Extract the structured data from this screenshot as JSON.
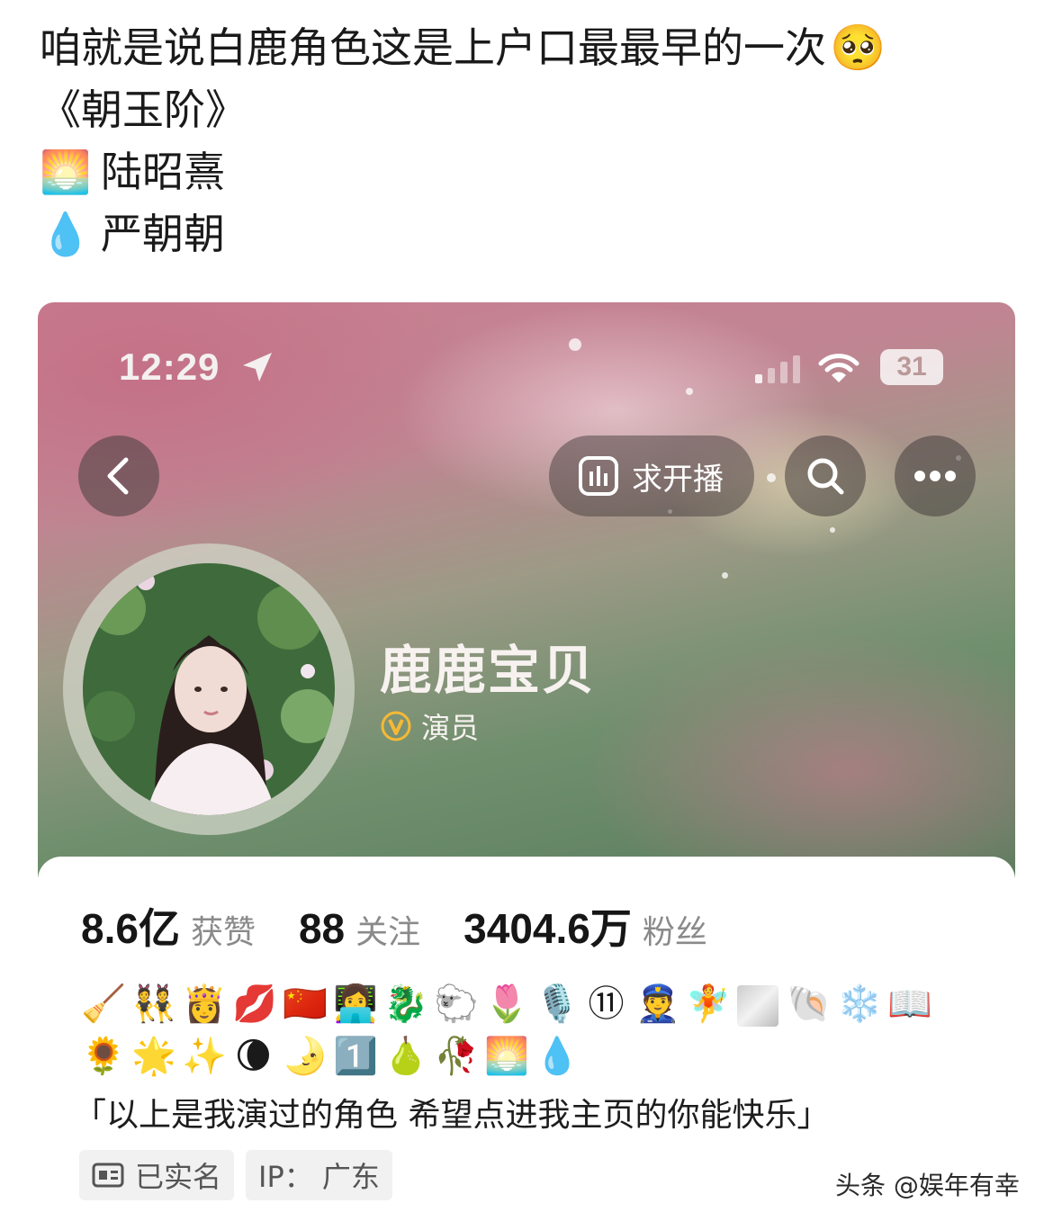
{
  "post": {
    "line1": "咱就是说白鹿角色这是上户口最最早的一次",
    "line1_emoji": "🥺",
    "line2": "《朝玉阶》",
    "line3_emoji": "🌅",
    "line3": "陆昭熹",
    "line4_emoji": "💧",
    "line4": "严朝朝"
  },
  "screenshot": {
    "status_bar": {
      "time": "12:29",
      "battery": "31"
    },
    "top_bar": {
      "live_request_label": "求开播"
    },
    "profile": {
      "nickname": "鹿鹿宝贝",
      "verify_label": "演员",
      "stats": [
        {
          "value": "8.6亿",
          "label": "获赞"
        },
        {
          "value": "88",
          "label": "关注"
        },
        {
          "value": "3404.6万",
          "label": "粉丝"
        }
      ],
      "emoji_row1": [
        "🧹",
        "👯",
        "👸",
        "💋",
        "🇨🇳",
        "👩‍💻",
        "🐉",
        "🐑",
        "🌷",
        "🎙️",
        "⑪",
        "👮",
        "🧚",
        "",
        "🐚",
        "❄️",
        "📖"
      ],
      "emoji_row2": [
        "🌻",
        "🌟",
        "✨",
        "🌘",
        "🌛",
        "1️⃣",
        "🍐",
        "🥀",
        "🌅",
        "💧"
      ],
      "bio": "「以上是我演过的角色 希望点进我主页的你能快乐」",
      "tags": {
        "realname": "已实名",
        "ip": "IP：  广东"
      }
    }
  },
  "watermark": "头条 @娱年有幸"
}
